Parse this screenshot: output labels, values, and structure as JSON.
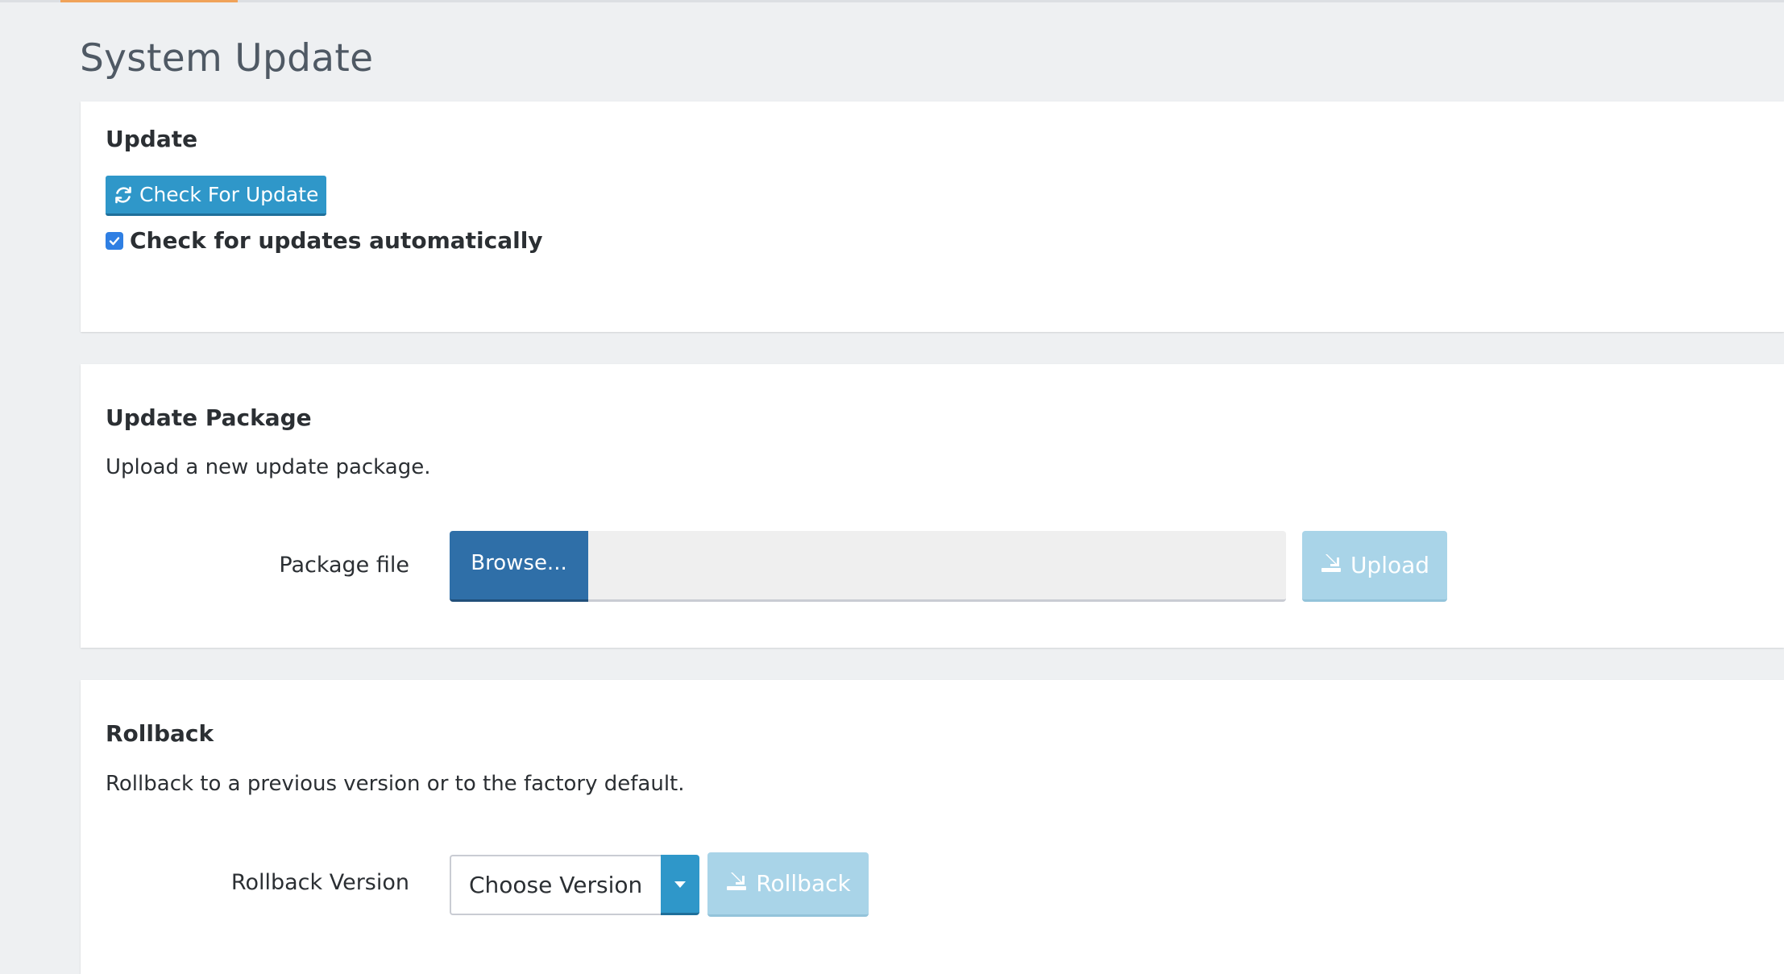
{
  "page": {
    "title": "System Update"
  },
  "update_panel": {
    "title": "Update",
    "check_button_label": "Check For Update",
    "check_button_icon": "refresh-icon",
    "auto_check_label": "Check for updates automatically",
    "auto_check_checked": true
  },
  "package_panel": {
    "title": "Update Package",
    "description": "Upload a new update package.",
    "file_label": "Package file",
    "browse_label": "Browse...",
    "file_value": "",
    "upload_label": "Upload",
    "upload_icon": "upload-icon",
    "upload_disabled": true
  },
  "rollback_panel": {
    "title": "Rollback",
    "description": "Rollback to a previous version or to the factory default.",
    "version_label": "Rollback Version",
    "version_selected": "Choose Version",
    "rollback_label": "Rollback",
    "rollback_icon": "upload-icon",
    "rollback_disabled": true
  },
  "colors": {
    "primary": "#2f97c9",
    "browse": "#2f6fa8",
    "disabled": "#a9d4e8",
    "checkbox": "#2f7fe3",
    "tab_accent": "#f0a35a",
    "background": "#eef0f2"
  }
}
